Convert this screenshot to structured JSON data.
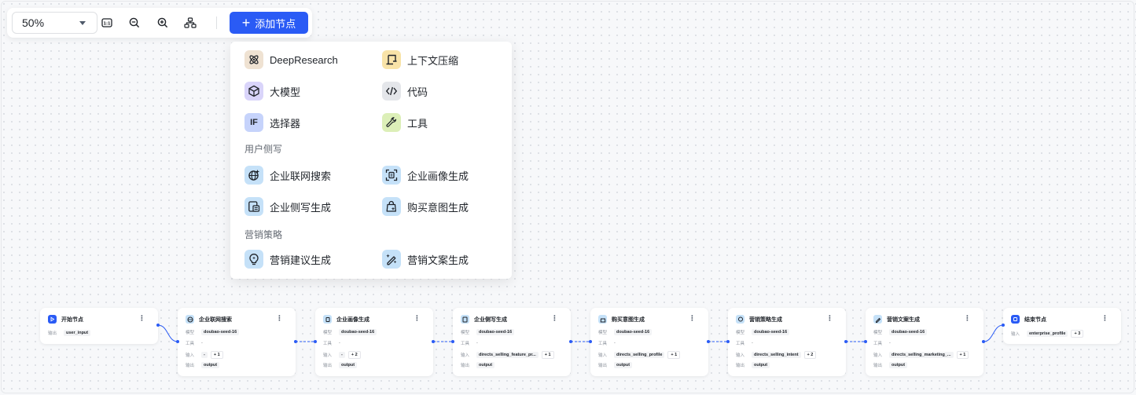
{
  "toolbar": {
    "zoom": "50%",
    "fit_icon": "fit-view-icon",
    "zoom_out_icon": "zoom-out-icon",
    "zoom_in_icon": "zoom-in-icon",
    "layout_icon": "auto-layout-icon",
    "add_node_label": "添加节点"
  },
  "menu": {
    "top_items": [
      {
        "label": "DeepResearch",
        "icon": "deep-research-icon"
      },
      {
        "label": "上下文压缩",
        "icon": "context-compress-icon"
      },
      {
        "label": "大模型",
        "icon": "llm-icon"
      },
      {
        "label": "代码",
        "icon": "code-icon"
      },
      {
        "label": "选择器",
        "icon": "if-selector-icon"
      },
      {
        "label": "工具",
        "icon": "tool-icon"
      }
    ],
    "groups": [
      {
        "title": "用户侧写",
        "items": [
          {
            "label": "企业联网搜索",
            "icon": "web-search-icon"
          },
          {
            "label": "企业画像生成",
            "icon": "enterprise-profile-icon"
          },
          {
            "label": "企业侧写生成",
            "icon": "enterprise-sketch-icon"
          },
          {
            "label": "购买意图生成",
            "icon": "purchase-intent-icon"
          }
        ]
      },
      {
        "title": "营销策略",
        "items": [
          {
            "label": "营销建议生成",
            "icon": "marketing-advice-icon"
          },
          {
            "label": "营销文案生成",
            "icon": "marketing-copy-icon"
          }
        ]
      }
    ]
  },
  "labels": {
    "model": "模型",
    "tool": "工具",
    "input": "输入",
    "output": "输出",
    "dash": "-"
  },
  "nodes": [
    {
      "title": "开始节点",
      "output": "user_input"
    },
    {
      "title": "企业联网搜索",
      "model": "doubao-seed-16",
      "tool": "-",
      "input": "-",
      "input_more": "+ 1",
      "output": "output"
    },
    {
      "title": "企业画像生成",
      "model": "doubao-seed-16",
      "tool": "-",
      "input": "-",
      "input_more": "+ 2",
      "output": "output"
    },
    {
      "title": "企业侧写生成",
      "model": "doubao-seed-16",
      "tool": "-",
      "input": "directs_selling_feature_pr...",
      "input_more": "+ 1",
      "output": "output"
    },
    {
      "title": "购买意图生成",
      "model": "doubao-seed-16",
      "tool": "-",
      "input": "directs_selling_profile",
      "input_more": "+ 1",
      "output": "output"
    },
    {
      "title": "营销策略生成",
      "model": "doubao-seed-16",
      "tool": "-",
      "input": "directs_selling_intent",
      "input_more": "+ 2",
      "output": "output"
    },
    {
      "title": "营销文案生成",
      "model": "doubao-seed-16",
      "tool": "-",
      "input": "directs_selling_marketing_...",
      "input_more": "+ 1",
      "output": "output"
    },
    {
      "title": "结束节点",
      "input": "enterprise_profile",
      "input_more": "+ 3"
    }
  ],
  "colors": {
    "accent": "#2a5bf5"
  }
}
